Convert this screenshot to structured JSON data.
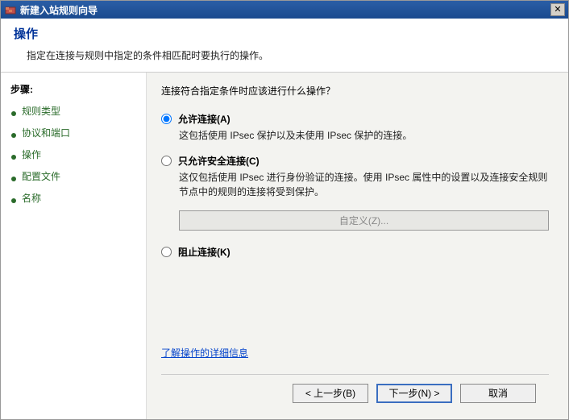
{
  "titlebar": {
    "title": "新建入站规则向导"
  },
  "header": {
    "title": "操作",
    "desc": "指定在连接与规则中指定的条件相匹配时要执行的操作。"
  },
  "sidebar": {
    "heading": "步骤:",
    "items": [
      {
        "label": "规则类型"
      },
      {
        "label": "协议和端口"
      },
      {
        "label": "操作"
      },
      {
        "label": "配置文件"
      },
      {
        "label": "名称"
      }
    ]
  },
  "content": {
    "question": "连接符合指定条件时应该进行什么操作？",
    "options": {
      "allow": {
        "label": "允许连接(A)",
        "desc": "这包括使用 IPsec 保护以及未使用 IPsec 保护的连接。"
      },
      "secure": {
        "label": "只允许安全连接(C)",
        "desc": "这仅包括使用 IPsec 进行身份验证的连接。使用 IPsec 属性中的设置以及连接安全规则节点中的规则的连接将受到保护。"
      },
      "block": {
        "label": "阻止连接(K)"
      }
    },
    "customize_label": "自定义(Z)...",
    "learn_more": "了解操作的详细信息"
  },
  "footer": {
    "back": "< 上一步(B)",
    "next": "下一步(N) >",
    "cancel": "取消"
  },
  "colors": {
    "title_blue": "#1a4a8e",
    "link": "#0645cc",
    "step_green": "#2a6b2a"
  }
}
